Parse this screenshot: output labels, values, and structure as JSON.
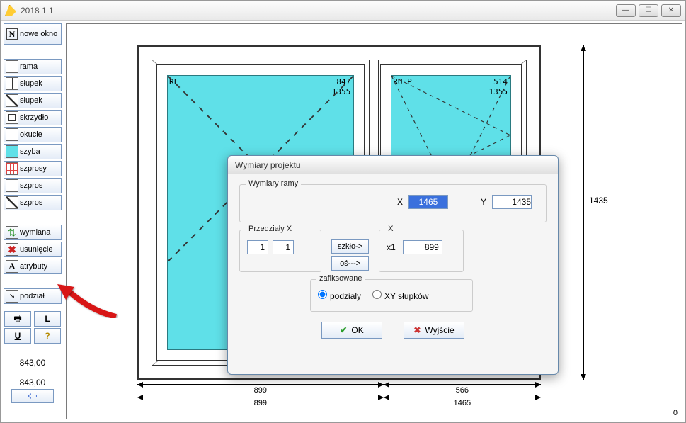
{
  "window": {
    "title": "2018   1   1"
  },
  "sidebar": {
    "nowe_okno": "nowe okno",
    "rama": "rama",
    "slupek1": "słupek",
    "slupek2": "słupek",
    "skrzydlo": "skrzydło",
    "okucie": "okucie",
    "szyba": "szyba",
    "szprosy": "szprosy",
    "szpros1": "szpros",
    "szpros2": "szpros",
    "wymiana": "wymiana",
    "usuniecie": "usunięcie",
    "atrybuty": "atrybuty",
    "podzial": "podział",
    "L": "L",
    "U": "U",
    "Q": "?",
    "num1": "843,00",
    "num2": "843,00"
  },
  "drawing": {
    "left": {
      "code": "RL",
      "w": "847",
      "h": "1355"
    },
    "right": {
      "code": "RU P",
      "w": "514",
      "h": "1355"
    },
    "height": "1435",
    "dims_top": [
      "899",
      "566"
    ],
    "dims_bot": [
      "899",
      "1465"
    ]
  },
  "dialog": {
    "title": "Wymiary projektu",
    "frame_legend": "Wymiary ramy",
    "x_label": "X",
    "y_label": "Y",
    "x_val": "1465",
    "y_val": "1435",
    "przedzialy_legend": "Przedziały X",
    "p1": "1",
    "p2": "1",
    "szklo": "szkło->",
    "os": "oś--->",
    "x_section": "X",
    "x1_label": "x1",
    "x1_val": "899",
    "fixed_legend": "zafiksowane",
    "radio1": "podzialy",
    "radio2": "XY słupków",
    "ok": "OK",
    "exit": "Wyjście"
  },
  "misc": {
    "zero": "0"
  }
}
